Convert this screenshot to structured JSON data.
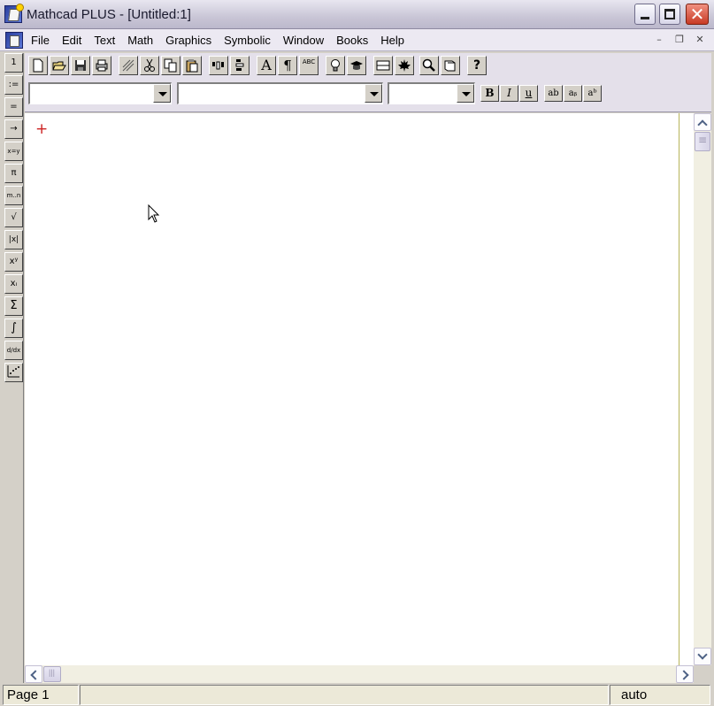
{
  "window": {
    "title": "Mathcad PLUS - [Untitled:1]",
    "controls": {
      "minimize": "_",
      "maximize": "□",
      "close": "✕"
    }
  },
  "menu": {
    "items": [
      "File",
      "Edit",
      "Text",
      "Math",
      "Graphics",
      "Symbolic",
      "Window",
      "Books",
      "Help"
    ],
    "mdi_controls": {
      "minimize": "–",
      "restore": "❐",
      "close": "✕"
    }
  },
  "math_palette": {
    "buttons": [
      "1",
      ":=",
      "=",
      "→",
      "x=y",
      "π",
      "m..n",
      "√",
      "|x|",
      "xʸ",
      "xᵢ",
      "Σ",
      "∫",
      "d/dx",
      "graph"
    ]
  },
  "toolbar": {
    "buttons": [
      "new",
      "open",
      "save",
      "print",
      "cut-region",
      "cut",
      "copy",
      "paste",
      "align-across",
      "align-down",
      "insert-text",
      "paragraph",
      "spell-check",
      "tip",
      "tutorial",
      "math-region",
      "maple",
      "zoom",
      "resources",
      "help"
    ],
    "labels": {
      "insert-text": "A",
      "paragraph": "¶",
      "spell-check": "ABC",
      "help": "?"
    }
  },
  "format_bar": {
    "style_combo": "",
    "font_combo": "",
    "size_combo": "",
    "buttons": {
      "bold": "B",
      "italic": "I",
      "underline": "u",
      "normal": "ab",
      "subscript": "aᵦ",
      "superscript": "aᵇ"
    }
  },
  "document": {
    "cursor_glyph": "+"
  },
  "statusbar": {
    "page": "Page 1",
    "message": "",
    "mode": "auto"
  }
}
